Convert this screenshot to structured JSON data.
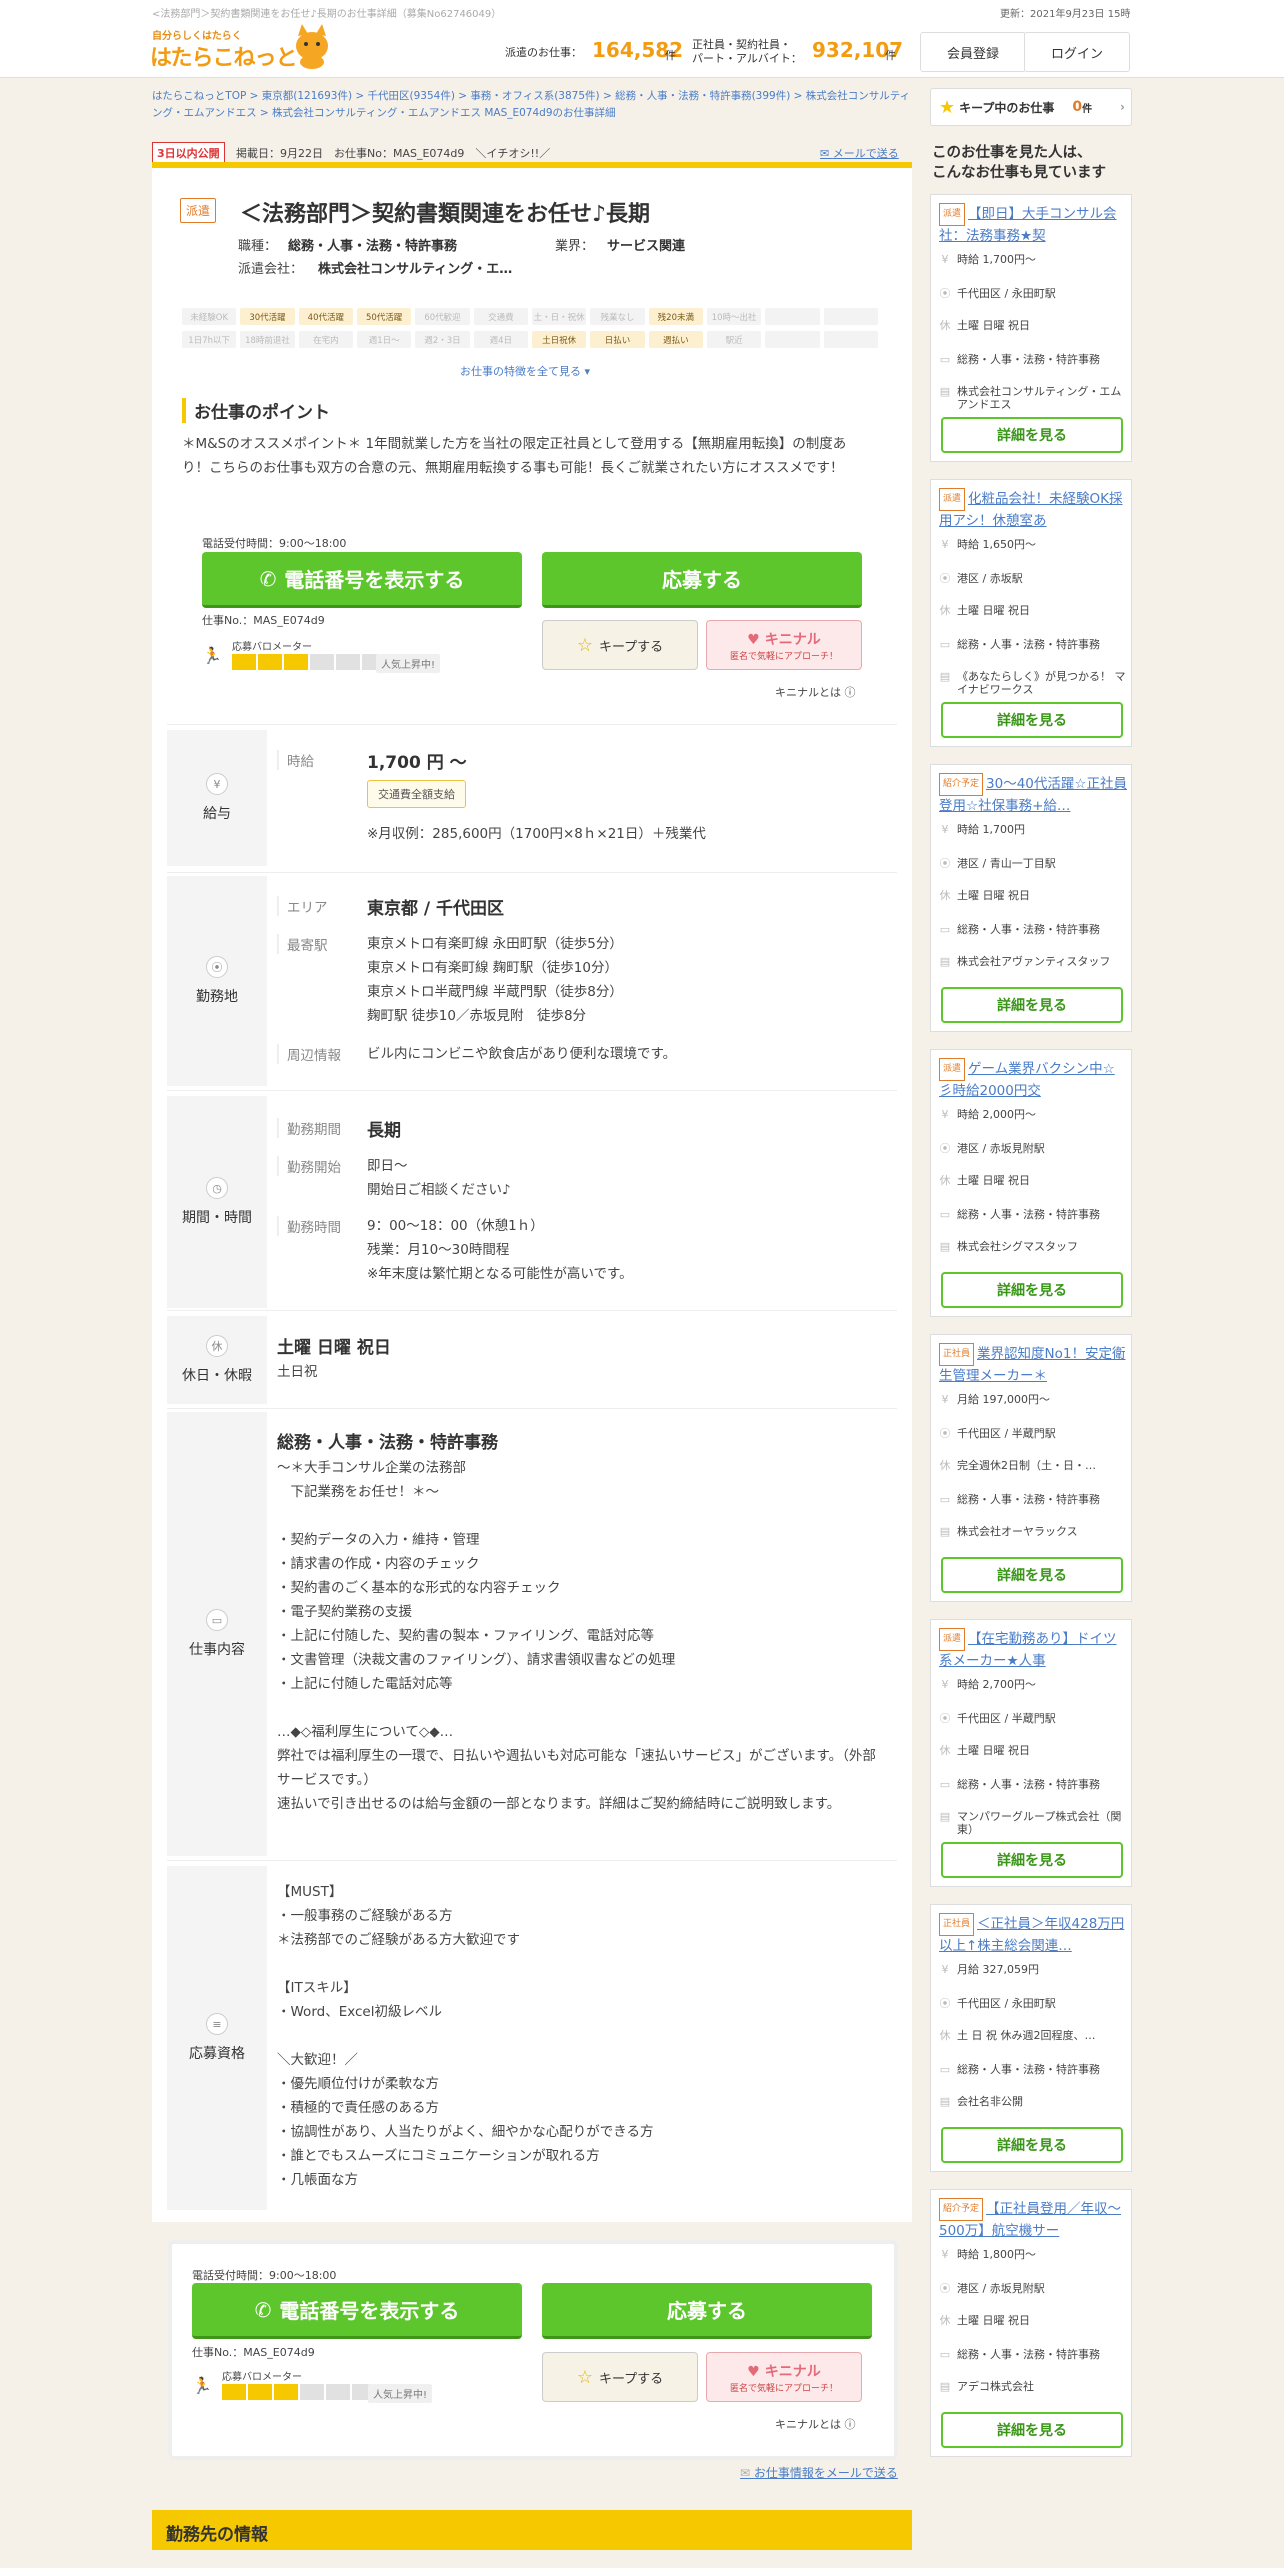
{
  "header": {
    "seo_text": "<法務部門＞契約書類関連をお任せ♪長期のお仕事詳細（募集No62746049）",
    "updated": "更新：2021年9月23日 15時",
    "logo_tagline": "自分らしくはたらく",
    "logo_text": "はたらこねっと",
    "stat1_label": "派遣のお仕事：",
    "stat1_value": "164,582",
    "stat1_unit": "件",
    "stat2_label1": "正社員・契約社員・",
    "stat2_label2": "パート・アルバイト：",
    "stat2_value": "932,107",
    "stat2_unit": "件",
    "register": "会員登録",
    "login": "ログイン"
  },
  "breadcrumb": {
    "line1": "はたらこねっとTOP > 東京都(121693件) > 千代田区(9354件) > 事務・オフィス系(3875件) > 総務・人事・法務・特許事務(399件) > 株式会社コンサルティ",
    "line2": "ング・エムアンドエス > 株式会社コンサルティング・エムアンドエス MAS_E074d9のお仕事詳細"
  },
  "job": {
    "publish_badge": "3日以内公開",
    "posted": "掲載日：9月22日　お仕事No：MAS_E074d9　＼イチオシ!!／",
    "mail_link": "メールで送る",
    "type_badge": "派遣",
    "title": "＜法務部門＞契約書類関連をお任せ♪長期",
    "occupation_label": "職種：",
    "occupation": "総務・人事・法務・特許事務",
    "industry_label": "業界：",
    "industry": "サービス関連",
    "company_label": "派遣会社：",
    "company": "株式会社コンサルティング・エ…"
  },
  "tags": [
    {
      "t": "未経験OK",
      "on": false
    },
    {
      "t": "30代活躍",
      "on": true
    },
    {
      "t": "40代活躍",
      "on": true
    },
    {
      "t": "50代活躍",
      "on": true
    },
    {
      "t": "60代歓迎",
      "on": false
    },
    {
      "t": "交通費",
      "on": false
    },
    {
      "t": "土・日・祝休",
      "on": false
    },
    {
      "t": "残業なし",
      "on": false
    },
    {
      "t": "残20未満",
      "on": true
    },
    {
      "t": "10時〜出社",
      "on": false
    },
    {
      "t": "",
      "on": false
    },
    {
      "t": "",
      "on": false
    },
    {
      "t": "1日7h以下",
      "on": false
    },
    {
      "t": "18時前退社",
      "on": false
    },
    {
      "t": "在宅内",
      "on": false
    },
    {
      "t": "週1日〜",
      "on": false
    },
    {
      "t": "週2・3日",
      "on": false
    },
    {
      "t": "週4日",
      "on": false
    },
    {
      "t": "土日祝休",
      "on": true
    },
    {
      "t": "日払い",
      "on": true
    },
    {
      "t": "週払い",
      "on": true
    },
    {
      "t": "駅近",
      "on": false
    },
    {
      "t": "",
      "on": false
    },
    {
      "t": "",
      "on": false
    }
  ],
  "see_all": "お仕事の特徴を全て見る ▾",
  "points": {
    "heading": "お仕事のポイント",
    "text": "＊M&Sのオススメポイント＊ 1年間就業した方を当社の限定正社員として登用する【無期雇用転換】の制度あり！こちらのお仕事も双方の合意の元、無期雇用転換する事も可能！長くご就業されたい方にオススメです！"
  },
  "apply": {
    "tel_hours": "電話受付時間：9:00～18:00",
    "tel_button": "電話番号を表示する",
    "apply_button": "応募する",
    "job_no": "仕事No.：MAS_E074d9",
    "meter_label": "応募バロメーター",
    "meter_level": 3,
    "meter_max": 6,
    "popular": "人気上昇中!",
    "keep": "キープする",
    "kininal": "キニナル",
    "kininal_sub": "匿名で気軽にアプローチ！",
    "kininal_what": "キニナルとは"
  },
  "salary": {
    "section": "給与",
    "key": "時給",
    "value": "1,700 円 ～",
    "badge": "交通費全額支給",
    "example": "※月収例：285,600円（1700円×8ｈ×21日）＋残業代"
  },
  "location": {
    "section": "勤務地",
    "area_key": "エリア",
    "area": "東京都 / 千代田区",
    "station_key": "最寄駅",
    "stations": [
      "東京メトロ有楽町線 永田町駅（徒歩5分）",
      "東京メトロ有楽町線 麹町駅（徒歩10分）",
      "東京メトロ半蔵門線 半蔵門駅（徒歩8分）",
      "麹町駅 徒歩10／赤坂見附　徒歩8分"
    ],
    "env_key": "周辺情報",
    "env": "ビル内にコンビニや飲食店があり便利な環境です。"
  },
  "period": {
    "section": "期間・時間",
    "period_key": "勤務期間",
    "period": "長期",
    "start_key": "勤務開始",
    "start1": "即日～",
    "start2": "開始日ご相談ください♪",
    "time_key": "勤務時間",
    "time1": "9：00～18：00（休憩1ｈ）",
    "time2": "残業：月10～30時間程",
    "time3": "※年末度は繁忙期となる可能性が高いです。"
  },
  "holiday": {
    "section": "休日・休暇",
    "main": "土曜 日曜 祝日",
    "sub": "土日祝"
  },
  "work": {
    "section": "仕事内容",
    "title": "総務・人事・法務・特許事務",
    "lines": [
      "～＊大手コンサル企業の法務部",
      "　下記業務をお任せ！＊～",
      "",
      "・契約データの入力・維持・管理",
      "・請求書の作成・内容のチェック",
      "・契約書のごく基本的な形式的な内容チェック",
      "・電子契約業務の支援",
      "・上記に付随した、契約書の製本・ファイリング、電話対応等",
      "・文書管理（決裁文書のファイリング）、請求書領収書などの処理",
      "・上記に付随した電話対応等",
      "",
      "…◆◇福利厚生について◇◆…",
      "弊社では福利厚生の一環で、日払いや週払いも対応可能な「速払いサービス」がございます。（外部サービスです。）",
      "速払いで引き出せるのは給与金額の一部となります。詳細はご契約締結時にご説明致します。"
    ]
  },
  "qualification": {
    "section": "応募資格",
    "lines": [
      "【MUST】",
      "・一般事務のご経験がある方",
      "＊法務部でのご経験がある方大歓迎です",
      "",
      "【ITスキル】",
      "・Word、Excel初級レベル",
      "",
      "＼大歓迎！／",
      "・優先順位付けが柔軟な方",
      "・積極的で責任感のある方",
      "・協調性があり、人当たりがよく、細やかな心配りができる方",
      "・誰とでもスムーズにコミュニケーションが取れる方",
      "・几帳面な方"
    ]
  },
  "bottom_mail": "お仕事情報をメールで送る",
  "company_heading": "勤務先の情報",
  "sidebar": {
    "keep_label": "キープ中のお仕事",
    "keep_count": "0",
    "keep_unit": "件",
    "heading1": "このお仕事を見た人は、",
    "heading2": "こんなお仕事も見ています",
    "detail_btn": "詳細を見る",
    "cards": [
      {
        "cat": "派遣",
        "title": "【即日】大手コンサル会社：法務事務★契",
        "pay": "時給 1,700円～",
        "station": "千代田区 / 永田町駅",
        "holiday": "土曜 日曜 祝日",
        "job": "総務・人事・法務・特許事務",
        "company": "株式会社コンサルティング・エムアンドエス"
      },
      {
        "cat": "派遣",
        "title": "化粧品会社！未経験OK採用アシ！休憩室あ",
        "pay": "時給 1,650円～",
        "station": "港区 / 赤坂駅",
        "holiday": "土曜 日曜 祝日",
        "job": "総務・人事・法務・特許事務",
        "company": "《あなたらしく》が見つかる！ マイナビワークス"
      },
      {
        "cat": "紹介予定",
        "title": "30～40代活躍☆正社員登用☆社保事務+給…",
        "pay": "時給 1,700円",
        "station": "港区 / 青山一丁目駅",
        "holiday": "土曜 日曜 祝日",
        "job": "総務・人事・法務・特許事務",
        "company": "株式会社アヴァンティスタッフ"
      },
      {
        "cat": "派遣",
        "title": "ゲーム業界バクシン中☆彡時給2000円交",
        "pay": "時給 2,000円～",
        "station": "港区 / 赤坂見附駅",
        "holiday": "土曜 日曜 祝日",
        "job": "総務・人事・法務・特許事務",
        "company": "株式会社シグマスタッフ"
      },
      {
        "cat": "正社員",
        "title": "業界認知度No1！安定衛生管理メーカー＊",
        "pay": "月給 197,000円～",
        "station": "千代田区 / 半蔵門駅",
        "holiday": "完全週休2日制（土・日・…",
        "job": "総務・人事・法務・特許事務",
        "company": "株式会社オーヤラックス"
      },
      {
        "cat": "派遣",
        "title": "【在宅勤務あり】ドイツ系メーカー★人事",
        "pay": "時給 2,700円～",
        "station": "千代田区 / 半蔵門駅",
        "holiday": "土曜 日曜 祝日",
        "job": "総務・人事・法務・特許事務",
        "company": "マンパワーグループ株式会社（関東）"
      },
      {
        "cat": "正社員",
        "title": "＜正社員＞年収428万円以上↑株主総会関連…",
        "pay": "月給 327,059円",
        "station": "千代田区 / 永田町駅",
        "holiday": "土 日 祝 休み週2回程度、…",
        "job": "総務・人事・法務・特許事務",
        "company": "会社名非公開"
      },
      {
        "cat": "紹介予定",
        "title": "【正社員登用／年収～500万】航空機サー",
        "pay": "時給 1,800円～",
        "station": "港区 / 赤坂見附駅",
        "holiday": "土曜 日曜 祝日",
        "job": "総務・人事・法務・特許事務",
        "company": "アデコ株式会社"
      }
    ]
  }
}
